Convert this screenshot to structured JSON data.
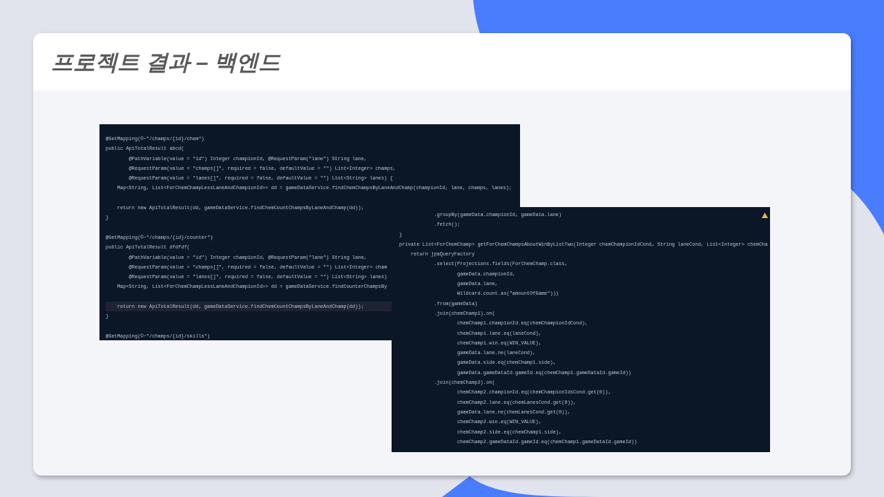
{
  "slide": {
    "title": "프로젝트 결과 – 백엔드"
  },
  "code_panels": [
    {
      "lines": [
        {
          "kind": "code",
          "text": "@GetMapping(©~\"/champs/{id}/chem\")"
        },
        {
          "kind": "code",
          "text": "public ApiTotalResult abcd("
        },
        {
          "kind": "code",
          "text": "        @PathVariable(value = \"id\") Integer championId, @RequestParam(\"lane\") String lane,"
        },
        {
          "kind": "code",
          "text": "        @RequestParam(value = \"champs[]\", required = false, defaultValue = \"\") List<Integer> champs,"
        },
        {
          "kind": "code",
          "text": "        @RequestParam(value = \"lanes[]\", required = false, defaultValue = \"\") List<String> lanes) {"
        },
        {
          "kind": "code",
          "text": "    Map<String, List<ForChemChampLessLaneAndChampionId>> dd = gameDataService.findChemChampsByLaneAndChamp(championId, lane, champs, lanes);"
        },
        {
          "kind": "blank"
        },
        {
          "kind": "code",
          "text": "    return new ApiTotalResult(dd, gameDataService.findChemCountChampsByLaneAndChamp(dd));"
        },
        {
          "kind": "code",
          "text": "}"
        },
        {
          "kind": "blank"
        },
        {
          "kind": "code",
          "text": "@GetMapping(©~\"/champs/{id}/counter\")"
        },
        {
          "kind": "code",
          "text": "public ApiTotalResult dfdfdf("
        },
        {
          "kind": "code",
          "text": "        @PathVariable(value = \"id\") Integer championId, @RequestParam(\"lane\") String lane,"
        },
        {
          "kind": "code",
          "text": "        @RequestParam(value = \"champs[]\", required = false, defaultValue = \"\") List<Integer> cham"
        },
        {
          "kind": "code",
          "text": "        @RequestParam(value = \"lanes[]\", required = false, defaultValue = \"\") List<String> lanes)"
        },
        {
          "kind": "code",
          "text": "    Map<String, List<ForChemChampLessLaneAndChampionId>> dd = gameDataService.findCounterChampsBy"
        },
        {
          "kind": "blank"
        },
        {
          "kind": "current",
          "text": "    return new ApiTotalResult(dd, gameDataService.findChemCountChampsByLaneAndChamp(dd));"
        },
        {
          "kind": "code",
          "text": "}"
        },
        {
          "kind": "blank"
        },
        {
          "kind": "code",
          "text": "@GetMapping(©~\"/champs/{id}/skills\")"
        }
      ]
    },
    {
      "warning": true,
      "lines": [
        {
          "kind": "code",
          "text": "            .groupBy(gameData.championId, gameData.lane)"
        },
        {
          "kind": "code",
          "text": "            .fetch();"
        },
        {
          "kind": "code",
          "text": "}"
        },
        {
          "kind": "code",
          "text": "private List<ForChemChamp> getForChemChampsAboutWinByListTwo(Integer chemChampionIdCond, String laneCond, List<Integer> chemCha"
        },
        {
          "kind": "code",
          "text": "    return jpaQueryFactory"
        },
        {
          "kind": "code",
          "text": "            .select(Projections.fields(ForChemChamp.class,"
        },
        {
          "kind": "code",
          "text": "                    gameData.championId,"
        },
        {
          "kind": "code",
          "text": "                    gameData.lane,"
        },
        {
          "kind": "code",
          "text": "                    Wildcard.count.as(\"amountOfGame\")))"
        },
        {
          "kind": "code",
          "text": "            .from(gameData)"
        },
        {
          "kind": "code",
          "text": "            .join(chemChamp1).on("
        },
        {
          "kind": "code",
          "text": "                    chemChamp1.championId.eq(chemChampionIdCond),"
        },
        {
          "kind": "code",
          "text": "                    chemChamp1.lane.eq(laneCond),"
        },
        {
          "kind": "code",
          "text": "                    chemChamp1.win.eq(WIN_VALUE),"
        },
        {
          "kind": "code",
          "text": "                    gameData.lane.ne(laneCond),"
        },
        {
          "kind": "code",
          "text": "                    gameData.side.eq(chemChamp1.side),"
        },
        {
          "kind": "code",
          "text": "                    gameData.gameDataId.gameId.eq(chemChamp1.gameDataId.gameId))"
        },
        {
          "kind": "code",
          "text": "            .join(chemChamp2).on("
        },
        {
          "kind": "code",
          "text": "                    chemChamp2.championId.eq(chemChampionIdsCond.get(0)),"
        },
        {
          "kind": "code",
          "text": "                    chemChamp2.lane.eq(chemLanesCond.get(0)),"
        },
        {
          "kind": "code",
          "text": "                    gameData.lane.ne(chemLanesCond.get(0)),"
        },
        {
          "kind": "code",
          "text": "                    chemChamp2.win.eq(WIN_VALUE),"
        },
        {
          "kind": "code",
          "text": "                    chemChamp2.side.eq(chemChamp1.side),"
        },
        {
          "kind": "code",
          "text": "                    chemChamp2.gameDataId.gameId.eq(chemChamp1.gameDataId.gameId))"
        }
      ]
    }
  ]
}
